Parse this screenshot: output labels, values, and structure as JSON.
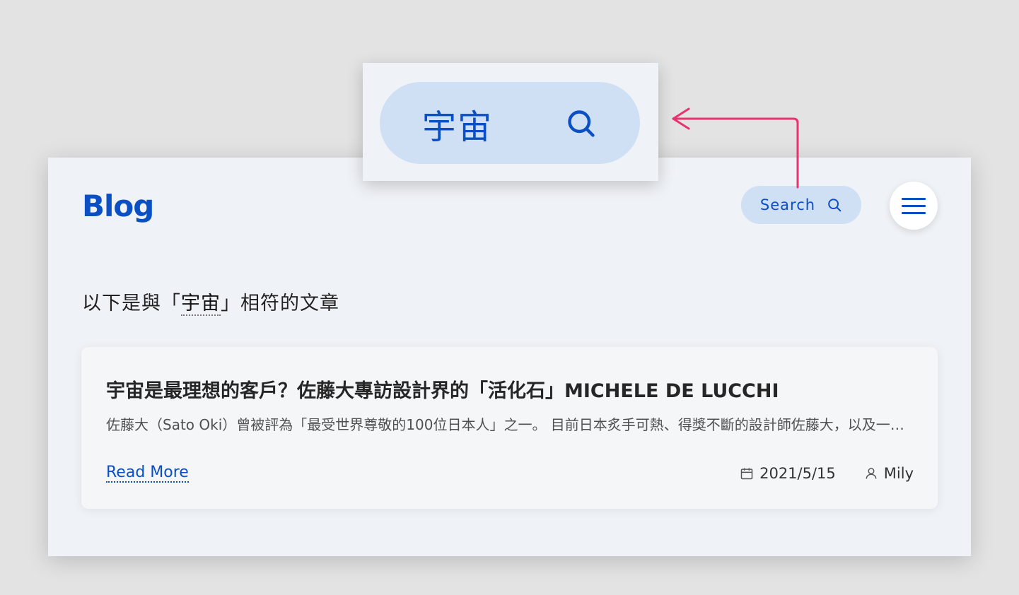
{
  "header": {
    "logo": "Blog",
    "search_label": "Search"
  },
  "zoom": {
    "search_value": "宇宙"
  },
  "results": {
    "prefix": "以下是與「",
    "keyword": "宇宙",
    "suffix": "」相符的文章"
  },
  "article": {
    "title": "宇宙是最理想的客戶？佐藤大專訪設計界的「活化石」MICHELE DE LUCCHI",
    "excerpt": "佐藤大（Sato Oki）曾被評為「最受世界尊敬的100位日本人」之一。 目前日本炙手可熱、得獎不斷的設計師佐藤大，以及一個他身後所面對的世界",
    "read_more": "Read More",
    "date": "2021/5/15",
    "author": "Mily"
  },
  "colors": {
    "accent": "#0a4fc4",
    "pill": "#cfe0f4",
    "arrow": "#e8336e"
  },
  "icons": [
    "search-icon",
    "menu-icon",
    "calendar-icon",
    "user-icon",
    "arrow-icon"
  ]
}
